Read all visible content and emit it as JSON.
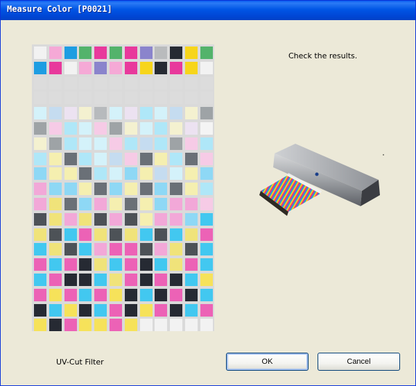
{
  "window": {
    "title": "Measure Color [P0021]"
  },
  "message": "Check the results.",
  "filter_label": "UV-Cut Filter",
  "buttons": {
    "ok": "OK",
    "cancel": "Cancel"
  },
  "palette": {
    "W": "#f2f2f2",
    "V": "#dcdcdc",
    "P": "#f5a9d6",
    "C": "#1d9de2",
    "G": "#53b36b",
    "M": "#e8399c",
    "Y": "#f7d51b",
    "U": "#8a84cc",
    "S": "#b9bbbd",
    "K": "#262a33",
    "D": "#4d5257",
    "N": "#6a7077",
    "L": "#9ea3a6",
    "a": "#d4f2fa",
    "b": "#c5dcf0",
    "c": "#ece2f1",
    "d": "#f4f1d0",
    "e": "#afe7f8",
    "f": "#f6cbe6",
    "g": "#f5efb0",
    "h": "#8ed8f5",
    "i": "#f2a8d8",
    "j": "#f0e37a",
    "k": "#42c8f0",
    "m": "#ec62b6",
    "n": "#f6e25a",
    "o": "#b7babd",
    "p": "#f4f4f4"
  },
  "chart_rows": [
    "WPCGMGMUSKYG",
    "CMWPUPMYKMYW",
    "VVVVVVVVVVVV",
    "VVVVVVVVVVVV",
    "abcdoaceabdL",
    "LfeafLdaedcp",
    "dLeaafebeLfe",
    "egNeabfNgeNf",
    "hggNeahgbagh",
    "ihhgNhgNhNge",
    "ijNhigNghiif",
    "DjijDiDgiihk",
    "jDkmjDjkDkjm",
    "kjDkimmDijDk",
    "mkmKjkmKkjmk",
    "kmKKkjmKmKkn",
    "mnmkmnKkKmKk",
    "KknKkmKnmKkm",
    "nKmnnmnWWWWW"
  ]
}
